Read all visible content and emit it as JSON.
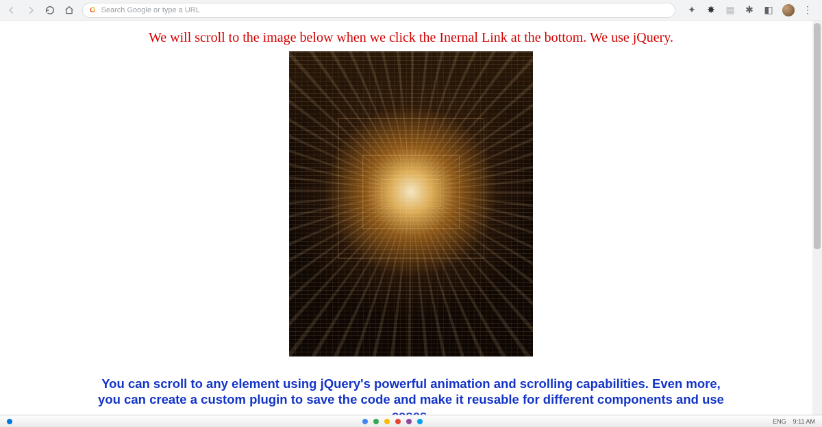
{
  "chrome": {
    "omnibox_placeholder": "Search Google or type a URL"
  },
  "page": {
    "red_heading": "We will scroll to the image below when we click the Inernal Link at the bottom. We use jQuery.",
    "blue_paragraph": "You can scroll to any element using jQuery's powerful animation and scrolling capabilities. Even more, you can create a custom plugin to save the code and make it reusable for different components and use cases."
  },
  "taskbar": {
    "lang": "ENG",
    "time": "9:11 AM"
  }
}
